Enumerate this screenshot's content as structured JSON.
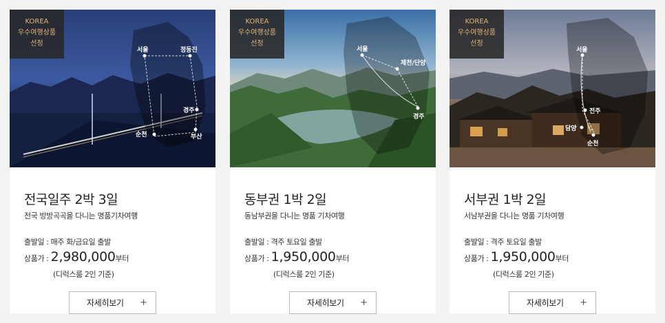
{
  "cards": [
    {
      "badge": [
        "KOREA",
        "우수여행상품",
        "선정"
      ],
      "title": "전국일주 2박 3일",
      "subtitle": "전국 방방곡곡을 다니는 명품기차여행",
      "depart": "출발일 : 매주 화/금요일 출발",
      "price_label": "상품가 : ",
      "price": "2,980,000",
      "price_unit": "부터",
      "note": "(디럭스룸 2인 기준)",
      "button": "자세히보기",
      "button_icon": "+",
      "cities": [
        "서울",
        "정동진",
        "경주",
        "순천",
        "부산"
      ]
    },
    {
      "badge": [
        "KOREA",
        "우수여행상품",
        "선정"
      ],
      "title": "동부권 1박 2일",
      "subtitle": "동남부권을 다니는 명품 기차여행",
      "depart": "출발일 : 격주 토요일 출발",
      "price_label": "상품가 : ",
      "price": "1,950,000",
      "price_unit": "부터",
      "note": "(디럭스룸 2인 기준)",
      "button": "자세히보기",
      "button_icon": "+",
      "cities": [
        "서울",
        "제천/단양",
        "경주"
      ]
    },
    {
      "badge": [
        "KOREA",
        "우수여행상품",
        "선정"
      ],
      "title": "서부권 1박 2일",
      "subtitle": "서남부권을 다니는 명품 기차여행",
      "depart": "출발일 : 격주 토요일 출발",
      "price_label": "상품가 : ",
      "price": "1,950,000",
      "price_unit": "부터",
      "note": "(디럭스룸 2인 기준)",
      "button": "자세히보기",
      "button_icon": "+",
      "cities": [
        "서울",
        "전주",
        "담양",
        "순천"
      ]
    }
  ],
  "colors": {
    "badge_text": "#e0b27a",
    "badge_bg": "#282828",
    "page_bg": "#f3f3f3"
  }
}
